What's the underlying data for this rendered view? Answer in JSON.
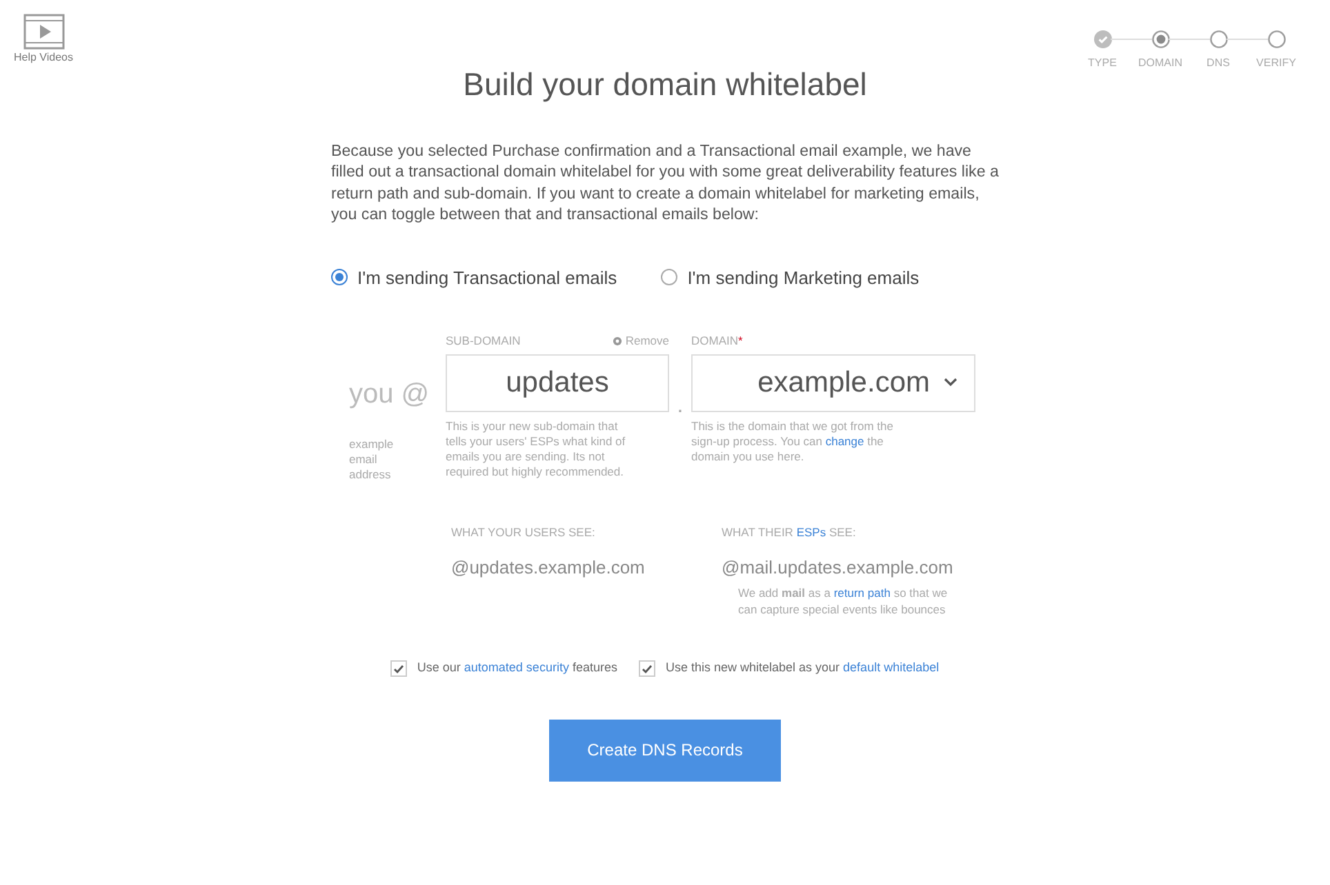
{
  "help_videos": {
    "label": "Help Videos"
  },
  "steps": [
    {
      "label": "TYPE",
      "completed": true,
      "selected": false
    },
    {
      "label": "DOMAIN",
      "completed": false,
      "selected": true
    },
    {
      "label": "DNS",
      "completed": false,
      "selected": false
    },
    {
      "label": "VERIFY",
      "completed": false,
      "selected": false
    }
  ],
  "title": "Build your domain whitelabel",
  "intro": "Because you selected Purchase confirmation and  a Transactional email example, we have filled out a transactional domain whitelabel for you with some great deliverability features like a return path and sub-domain. If you want to create a domain whitelabel for marketing emails, you can toggle between that and transactional emails below:",
  "email_types": [
    {
      "label": "I'm sending Transactional emails",
      "selected": true
    },
    {
      "label": "I'm sending Marketing emails",
      "selected": false
    }
  ],
  "prefix": "you @",
  "prefix_help": "example email address",
  "subdomain": {
    "label": "SUB-DOMAIN",
    "remove": "Remove",
    "value": "updates",
    "help": [
      {
        "text": "This is your new sub-domain that tells your users' ESPs what kind of emails you are sending. Its not required but highly recommended."
      }
    ]
  },
  "separator": ".",
  "domain": {
    "label": "DOMAIN",
    "required_mark": "*",
    "value": "example.com",
    "help": [
      {
        "text": "This is the domain that we got from the sign-up process. You can "
      },
      {
        "text": "change",
        "link": true
      },
      {
        "text": " the domain you use here."
      }
    ]
  },
  "users_see": {
    "label": [
      {
        "text": "WHAT YOUR USERS SEE:"
      }
    ],
    "value": "@updates.example.com"
  },
  "esps_see": {
    "label": [
      {
        "text": "WHAT THEIR "
      },
      {
        "text": "ESPs",
        "link": true
      },
      {
        "text": " SEE:"
      }
    ],
    "value": "@mail.updates.example.com",
    "note": [
      {
        "text": "We add **mail** as a "
      },
      {
        "text": "return path",
        "link": true
      },
      {
        "text": " so that we can capture special events like bounces"
      }
    ]
  },
  "options": [
    {
      "checked": true,
      "label": [
        {
          "text": "Use our "
        },
        {
          "text": "automated security",
          "link": true
        },
        {
          "text": " features"
        }
      ]
    },
    {
      "checked": true,
      "label": [
        {
          "text": "Use this new whitelabel as your "
        },
        {
          "text": "default whitelabel",
          "link": true
        }
      ]
    }
  ],
  "submit": "Create DNS Records"
}
